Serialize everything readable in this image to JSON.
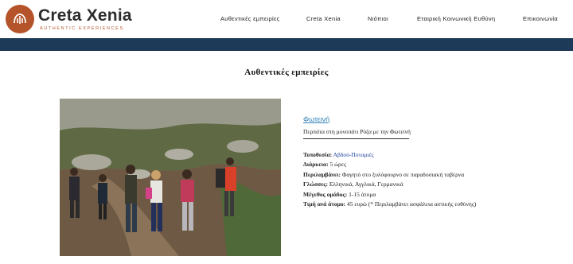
{
  "brand": {
    "name": "Creta Xenia",
    "tagline": "AUTHENTIC EXPERIENCES"
  },
  "nav": {
    "items": [
      {
        "label": "Αυθεντικές εμπειρίες"
      },
      {
        "label": "Creta Xenia"
      },
      {
        "label": "Νιόπιοι"
      },
      {
        "label": "Εταιρική Κοινωνική Ευθύνη"
      },
      {
        "label": "Επικοινωνία"
      }
    ]
  },
  "page": {
    "title": "Αυθεντικές εμπειρίες"
  },
  "experience": {
    "title": "Φωτεινή",
    "subtitle": "Περπάτα στη μονοπάτι Ρόζα με την Φωτεινή",
    "location_label": "Τοποθεσία:",
    "location_value": "Αβδού-Ποταμιές",
    "duration_label": "Διάρκεια:",
    "duration_value": "5 ώρες",
    "includes_label": "Περιλαμβάνει:",
    "includes_value": "Φαγητό στο ξυλόφουρνο σε παραδοσιακή ταβέρνα",
    "languages_label": "Γλώσσες:",
    "languages_value": "Ελληνικά, Αγγλικά, Γερμανικά",
    "group_label": "Μέγεθος ομάδος:",
    "group_value": "1-15 άτομα",
    "price_label": "Τιμή ανά άτομο:",
    "price_value": "45 ευρώ (* Περιλαμβάνει ασφάλεια αστικής ευθύνης)"
  },
  "colors": {
    "brand_orange": "#b5542a",
    "bar_navy": "#1d3a58",
    "link_blue": "#2d7fb5"
  }
}
